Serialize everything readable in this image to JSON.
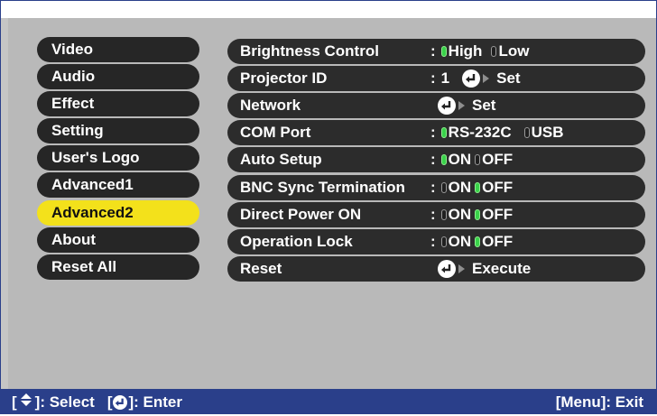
{
  "sidebar": {
    "items": [
      {
        "label": "Video",
        "selected": false
      },
      {
        "label": "Audio",
        "selected": false
      },
      {
        "label": "Effect",
        "selected": false
      },
      {
        "label": "Setting",
        "selected": false
      },
      {
        "label": "User's Logo",
        "selected": false
      },
      {
        "label": "Advanced1",
        "selected": false
      },
      {
        "label": "Advanced2",
        "selected": true
      },
      {
        "label": "About",
        "selected": false
      },
      {
        "label": "Reset All",
        "selected": false
      }
    ]
  },
  "settings": {
    "brightness": {
      "label": "Brightness Control",
      "opt1": "High",
      "opt2": "Low",
      "selected": "High"
    },
    "projector_id": {
      "label": "Projector ID",
      "value": "1",
      "action": "Set"
    },
    "network": {
      "label": "Network",
      "action": "Set"
    },
    "com_port": {
      "label": "COM Port",
      "opt1": "RS-232C",
      "opt2": "USB",
      "selected": "RS-232C"
    },
    "auto_setup": {
      "label": "Auto Setup",
      "opt1": "ON",
      "opt2": "OFF",
      "selected": "ON"
    },
    "bnc_sync": {
      "label": "BNC Sync Termination",
      "opt1": "ON",
      "opt2": "OFF",
      "selected": "OFF"
    },
    "direct_power": {
      "label": "Direct Power ON",
      "opt1": "ON",
      "opt2": "OFF",
      "selected": "OFF"
    },
    "operation_lock": {
      "label": "Operation Lock",
      "opt1": "ON",
      "opt2": "OFF",
      "selected": "OFF"
    },
    "reset": {
      "label": "Reset",
      "action": "Execute"
    }
  },
  "status": {
    "select_prefix": "[",
    "select_suffix": "]: Select",
    "enter_prefix": "[",
    "enter_suffix": "]: Enter",
    "exit": "[Menu]: Exit"
  },
  "colors": {
    "frame": "#2a3f8a",
    "panel": "#b9b9b9",
    "item": "#262626",
    "selected_item": "#f3e11b",
    "radio_on": "#39d24a"
  },
  "icons": {
    "enter": "enter-icon",
    "arrow": "right-arrow-icon",
    "updown": "up-down-icon"
  }
}
